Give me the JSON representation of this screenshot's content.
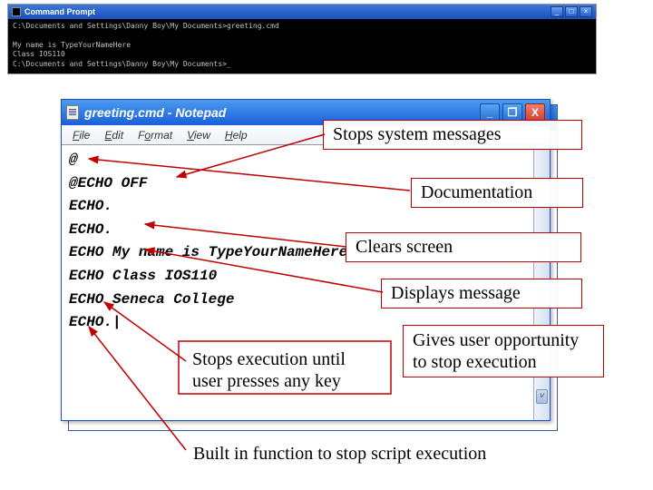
{
  "cmd": {
    "title": "Command Prompt",
    "body": "C:\\Documents and Settings\\Danny Boy\\My Documents>greeting.cmd\n\nMy name is TypeYourNameHere\nClass IOS110\nC:\\Documents and Settings\\Danny Boy\\My Documents>_"
  },
  "notepad": {
    "title": "greeting.cmd - Notepad",
    "menus": {
      "file": "File",
      "edit": "Edit",
      "format": "Format",
      "view": "View",
      "help": "Help"
    },
    "lines": [
      "@",
      "@ECHO OFF",
      "ECHO.",
      "ECHO.",
      "ECHO My name is TypeYourNameHere",
      "ECHO Class IOS110",
      "ECHO Seneca College",
      "ECHO.|"
    ],
    "buttons": {
      "min": "_",
      "max": "❐",
      "close": "X"
    }
  },
  "annotations": {
    "stops_msgs": "Stops system messages",
    "documentation": "Documentation",
    "clears": "Clears screen",
    "displays": "Displays message",
    "gives": "Gives user opportunity to stop execution",
    "stops_exec": "Stops execution until user presses any key",
    "builtin": "Built in function to stop script execution"
  }
}
